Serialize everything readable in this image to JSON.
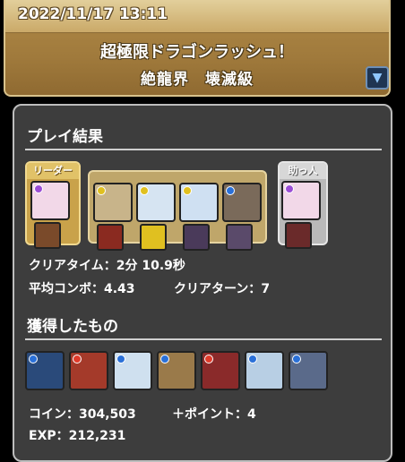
{
  "header": {
    "date": "2022/11/17 13:11",
    "dungeon_name": "超極限ドラゴンラッシュ！",
    "difficulty": "絶龍界　壊滅級",
    "dropdown_icon": "triangle-down-icon"
  },
  "result": {
    "title": "プレイ結果",
    "leader_tag": "リーダー",
    "helper_tag": "助っ人",
    "clear_time_label": "クリアタイム：",
    "clear_time_value": "2分 10.9秒",
    "avg_combo_label": "平均コンボ：",
    "avg_combo_value": "4.43",
    "clear_turn_label": "クリアターン：",
    "clear_turn_value": "7",
    "team": [
      {
        "role": "leader",
        "attr_color": "#9b4dd6",
        "bg": "#f2d8e8",
        "assist_bg": "#7a4a2a"
      },
      {
        "role": "sub",
        "attr_color": "#e0c020",
        "bg": "#c8b48a",
        "assist_bg": "#8a2a20"
      },
      {
        "role": "sub",
        "attr_color": "#e0c020",
        "bg": "#d6e4f2",
        "assist_bg": "#e0c020"
      },
      {
        "role": "sub",
        "attr_color": "#e0c020",
        "bg": "#cfe0f2",
        "assist_bg": "#4a3a5a"
      },
      {
        "role": "sub",
        "attr_color": "#2a70d8",
        "bg": "#7a6a5a",
        "assist_bg": "#5a4a6a"
      },
      {
        "role": "helper",
        "attr_color": "#9b4dd6",
        "bg": "#f2d8e8",
        "assist_bg": "#6a2a2a"
      }
    ]
  },
  "rewards": {
    "title": "獲得したもの",
    "coin_label": "コイン：",
    "coin_value": "304,503",
    "point_label": "＋ポイント：",
    "point_value": "4",
    "exp_label": "EXP：",
    "exp_value": "212,231",
    "drops": [
      {
        "attr_color": "#2a70d8",
        "bg": "#2a4a7a"
      },
      {
        "attr_color": "#e03a2a",
        "bg": "#a43a2a"
      },
      {
        "attr_color": "#2a70d8",
        "bg": "#cfe0ef"
      },
      {
        "attr_color": "#2a70d8",
        "bg": "#9a7a4a"
      },
      {
        "attr_color": "#e03a2a",
        "bg": "#8a2a2a"
      },
      {
        "attr_color": "#2a70d8",
        "bg": "#b8cfe4"
      },
      {
        "attr_color": "#2a70d8",
        "bg": "#5a6a8a"
      }
    ]
  }
}
